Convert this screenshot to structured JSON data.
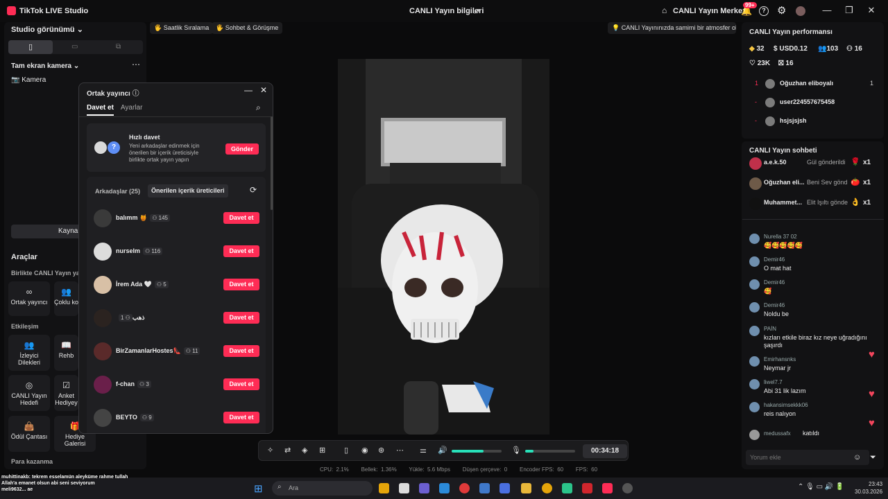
{
  "titlebar": {
    "app": "TikTok LIVE Studio",
    "center": "CANLI Yayın bilgileri",
    "home": "CANLI Yayın Merkezi",
    "badge": "99+"
  },
  "left": {
    "studio": "Studio görünümü",
    "camera_section": "Tam ekran kamera",
    "camera": "Kamera",
    "source_button": "Kaynak",
    "tools": "Araçlar",
    "together": "Birlikte CANLI Yayın yapın",
    "interaction": "Etkileşim",
    "earn": "Para kazanma",
    "tools_together": [
      {
        "label": "Ortak yayıncı"
      },
      {
        "label": "Çoklu ko"
      }
    ],
    "tools_interaction": [
      {
        "label": "İzleyici Dilekleri"
      },
      {
        "label": "Rehb"
      },
      {
        "label": "CANLI Yayın Hedefi"
      },
      {
        "label": "Anket Hediyey"
      },
      {
        "label": "Ödül Çantası"
      },
      {
        "label": "Hediye Galerisi"
      }
    ]
  },
  "pills": [
    "Saatlik Sıralama",
    "Sohbet & Görüşme",
    "CANLI Yayınınızda samimi bir atmosfer olu..."
  ],
  "modal": {
    "title": "Ortak yayıncı",
    "tab_active": "Davet et",
    "tab_other": "Ayarlar",
    "quick_title": "Hızlı davet",
    "quick_desc": "Yeni arkadaşlar edinmek için önerilen bir içerik üreticisiyle birlikte ortak yayın yapın",
    "send": "Gönder",
    "friends_tab": "Arkadaşlar (25)",
    "suggested_tab": "Önerilen içerik üreticileri",
    "invite": "Davet et",
    "rows": [
      {
        "name": "balımm 🍯",
        "count": "145",
        "color": "#3a3a3a"
      },
      {
        "name": "nurselm",
        "count": "116",
        "color": "#dcdcdc"
      },
      {
        "name": "İrem Ada 🤍",
        "count": "5",
        "color": "#d8c0a6"
      },
      {
        "name": "ذهب",
        "count": "1",
        "color": "#2b2320"
      },
      {
        "name": "BirZamanlarHostes👠",
        "count": "11",
        "color": "#5a2a2a"
      },
      {
        "name": "f-chan",
        "count": "3",
        "color": "#6a1f4a"
      },
      {
        "name": "BEYTO",
        "count": "9",
        "color": "#444"
      }
    ]
  },
  "bottom": {
    "timer": "00:34:18",
    "stats": "CPU:  2.1%        Bellek:  1.36%        Yükle:  5.6 Mbps        Düşen çerçeve:  0        Encoder FPS:  60        FPS:  60"
  },
  "perf": {
    "title": "CANLI Yayın performansı",
    "diamonds": "32",
    "usd": "USD0.12",
    "viewers": "103",
    "new": "16",
    "likes": "23K",
    "gifts": "16",
    "ranking": [
      {
        "rank": "1",
        "name": "Oğuzhan eliboyalı",
        "score": "1"
      },
      {
        "rank": "-",
        "name": "user224557675458",
        "score": ""
      },
      {
        "rank": "-",
        "name": "hsjsjsjsh",
        "score": ""
      }
    ]
  },
  "chat": {
    "title": "CANLI Yayın sohbeti",
    "gifts": [
      {
        "user": "a.e.k.50",
        "text": "Gül gönderildi",
        "count": "x1"
      },
      {
        "user": "Oğuzhan eli...",
        "text": "Beni Sev gönd",
        "count": "x1"
      },
      {
        "user": "Muhammet...",
        "text": "Elit Işıltı gönde",
        "count": "x1"
      }
    ],
    "messages": [
      {
        "user": "Nurella 37 02",
        "msg": "🥰🥰🥰🥰🥰"
      },
      {
        "user": "Demir46",
        "msg": "O mat hat"
      },
      {
        "user": "Demir46",
        "msg": "🥰"
      },
      {
        "user": "Demir46",
        "msg": "Noldu be"
      },
      {
        "user": "PAİN",
        "msg": "kızları etkile biraz kız neye uğradığını şaşırdı"
      },
      {
        "user": "Emirhansnks",
        "msg": "Neymar jr"
      },
      {
        "user": "liwel7.7",
        "msg": "Abi 31 lik lazım"
      },
      {
        "user": "hakansimsekkk06",
        "msg": "reis nalıyon"
      }
    ],
    "joined_user": "medussafx",
    "joined": "katıldı",
    "placeholder": "Yorum ekle"
  },
  "overlay": {
    "line1": "muhittinakb: tekrem esselamün aleyküme rahme tullah",
    "line2": "Allah'a emanet olsun abi seni seviyorum",
    "line3": "meli9632... ae"
  },
  "taskbar": {
    "search": "Ara",
    "time": "23:43",
    "date": "30.03.2026"
  }
}
